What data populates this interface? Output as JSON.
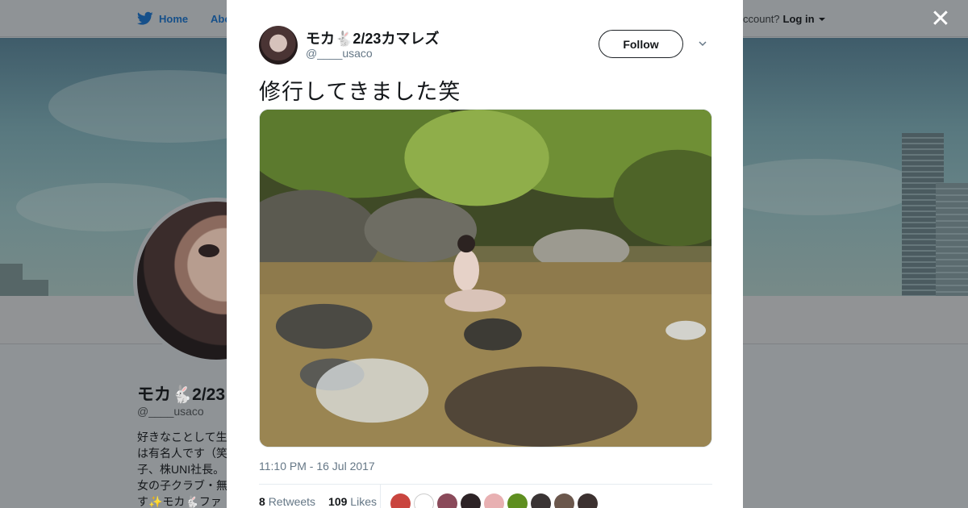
{
  "nav": {
    "home_label": "Home",
    "about_label": "Abo",
    "account_prompt": "ccount?",
    "login_label": "Log in"
  },
  "profile": {
    "name": "モカ🐇2/23",
    "handle": "@____usaco",
    "bio": "好きなことして生は有名人です（笑子、株UNI社長。女の子クラブ・無す✨モカ🐇ファ"
  },
  "tweet": {
    "author_name": "モカ🐇2/23カマレズ",
    "author_handle": "@____usaco",
    "follow_label": "Follow",
    "text": "修行してきました笑",
    "timestamp": "11:10 PM - 16 Jul 2017",
    "retweets_count": "8",
    "retweets_label": "Retweets",
    "likes_count": "109",
    "likes_label": "Likes"
  },
  "icons": {
    "brand": "twitter-bird-icon",
    "close": "close-icon",
    "menu": "chevron-down-icon"
  },
  "colors": {
    "link": "#16508a",
    "muted": "#657786",
    "text": "#14171a"
  }
}
